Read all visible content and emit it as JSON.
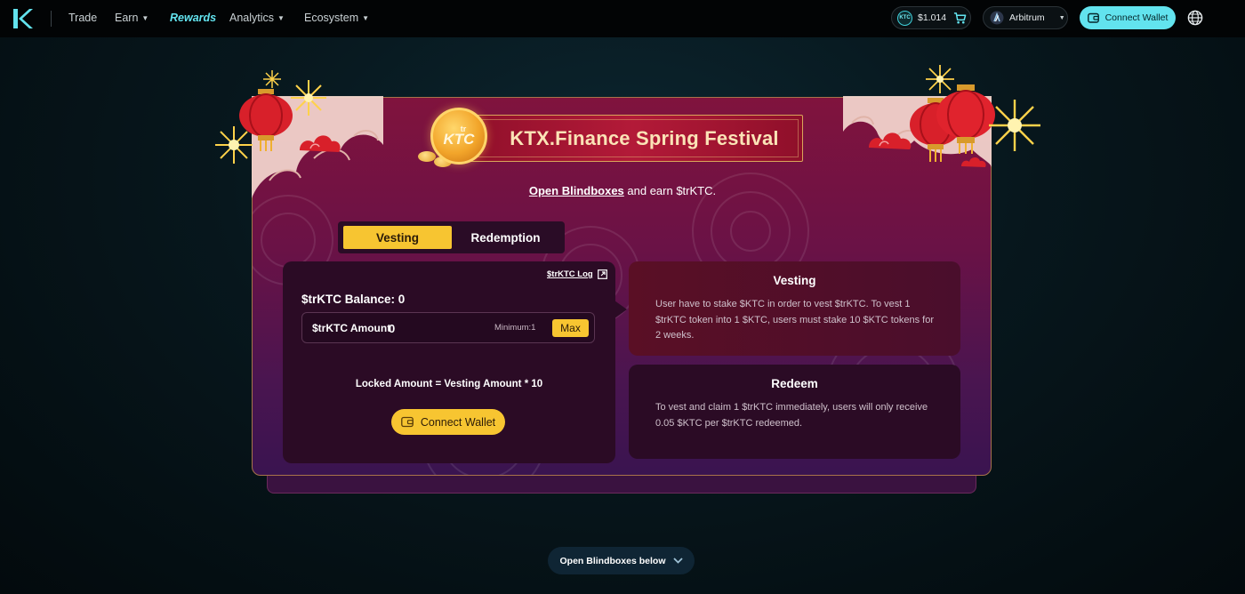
{
  "nav": {
    "items": [
      {
        "label": "Trade"
      },
      {
        "label": "Earn"
      },
      {
        "label": "Rewards"
      },
      {
        "label": "Analytics"
      },
      {
        "label": "Ecosystem"
      }
    ],
    "price_badge_text": "KTC",
    "price": "$1.014",
    "network": "Arbitrum",
    "connect_label": "Connect Wallet",
    "icons": [
      "ktx-logo-icon",
      "cart-icon",
      "arbitrum-icon",
      "wallet-icon",
      "globe-icon",
      "chevron-down-icon"
    ]
  },
  "festival": {
    "title": "KTX.Finance Spring Festival",
    "coin_top": "tr",
    "coin_main": "KTC",
    "subtitle_link": "Open Blindboxes",
    "subtitle_rest": " and earn $trKTC."
  },
  "tabs": [
    {
      "label": "Vesting",
      "active": true
    },
    {
      "label": "Redemption",
      "active": false
    }
  ],
  "form": {
    "log_link": "$trKTC Log",
    "balance": "$trKTC Balance: 0",
    "amount_label": "$trKTC Amount",
    "amount_value": "0",
    "minimum": "Minimum:1",
    "max_label": "Max",
    "locked_formula": "Locked Amount = Vesting Amount * 10",
    "connect_label": "Connect Wallet"
  },
  "info": {
    "vesting": {
      "title": "Vesting",
      "body": "User have to stake $KTC in order to vest $trKTC. To vest 1 $trKTC token into 1 $KTC, users must stake 10 $KTC tokens for 2 weeks."
    },
    "redeem": {
      "title": "Redeem",
      "body": "To vest and claim 1 $trKTC immediately, users will only receive 0.05 $KTC per $trKTC redeemed."
    }
  },
  "footer": {
    "open_below": "Open Blindboxes below"
  },
  "colors": {
    "accent_cyan": "#62e3ee",
    "accent_yellow": "#f7c531",
    "panel_red": "#80133d",
    "panel_purple": "#3a1450"
  }
}
